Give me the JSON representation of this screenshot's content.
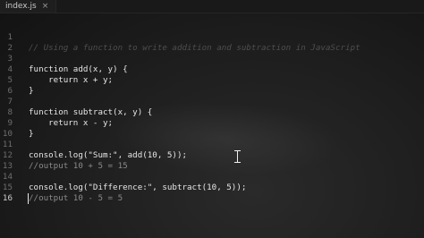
{
  "tab": {
    "filename": "index.js",
    "close_glyph": "×"
  },
  "editor": {
    "lines": [
      {
        "num": "1",
        "text": "// Using a function to write addition and subtraction in JavaScript"
      },
      {
        "num": "2",
        "text": ""
      },
      {
        "num": "3",
        "text": "function add(x, y) {"
      },
      {
        "num": "4",
        "text": "    return x + y;"
      },
      {
        "num": "5",
        "text": "}"
      },
      {
        "num": "6",
        "text": ""
      },
      {
        "num": "7",
        "text": "function subtract(x, y) {"
      },
      {
        "num": "8",
        "text": "    return x - y;"
      },
      {
        "num": "9",
        "text": "}"
      },
      {
        "num": "10",
        "text": ""
      },
      {
        "num": "11",
        "text": "console.log(\"Sum:\", add(10, 5));"
      },
      {
        "num": "12",
        "text": "//output 10 + 5 = 15"
      },
      {
        "num": "13",
        "text": ""
      },
      {
        "num": "14",
        "text": "console.log(\"Difference:\", subtract(10, 5));"
      },
      {
        "num": "15",
        "text": "//output 10 - 5 = 5"
      },
      {
        "num": "16",
        "text": ""
      }
    ]
  }
}
